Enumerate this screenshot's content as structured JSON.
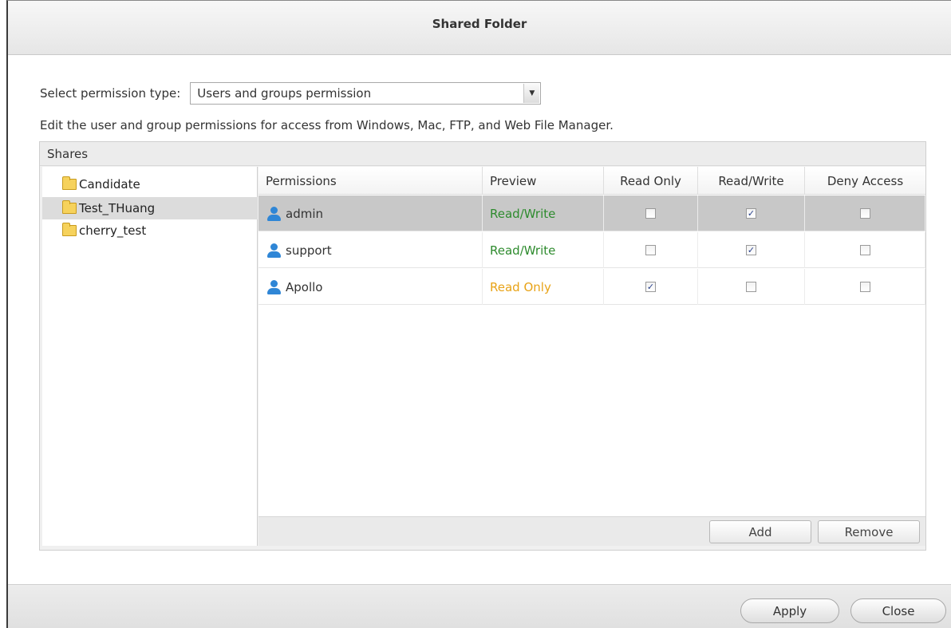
{
  "window": {
    "title": "Shared Folder"
  },
  "permission_type": {
    "label": "Select permission type:",
    "selected": "Users and groups permission"
  },
  "description": "Edit the user and group permissions for access from Windows, Mac, FTP, and Web File Manager.",
  "shares": {
    "header": "Shares",
    "folders": [
      "Candidate",
      "Test_THuang",
      "cherry_test"
    ],
    "selected_index": 1
  },
  "permissions_table": {
    "columns": [
      "Permissions",
      "Preview",
      "Read Only",
      "Read/Write",
      "Deny Access"
    ],
    "rows": [
      {
        "user": "admin",
        "preview": "Read/Write",
        "preview_color": "#2e8b2e",
        "read_only": false,
        "read_write": true,
        "deny": false,
        "selected": true
      },
      {
        "user": "support",
        "preview": "Read/Write",
        "preview_color": "#2e8b2e",
        "read_only": false,
        "read_write": true,
        "deny": false,
        "selected": false
      },
      {
        "user": "Apollo",
        "preview": "Read Only",
        "preview_color": "#e8a317",
        "read_only": true,
        "read_write": false,
        "deny": false,
        "selected": false
      }
    ],
    "add_label": "Add",
    "remove_label": "Remove"
  },
  "footer": {
    "apply_label": "Apply",
    "close_label": "Close"
  },
  "icons": {
    "folder": "folder-icon",
    "user": "user-icon",
    "dropdown": "chevron-down-icon"
  }
}
